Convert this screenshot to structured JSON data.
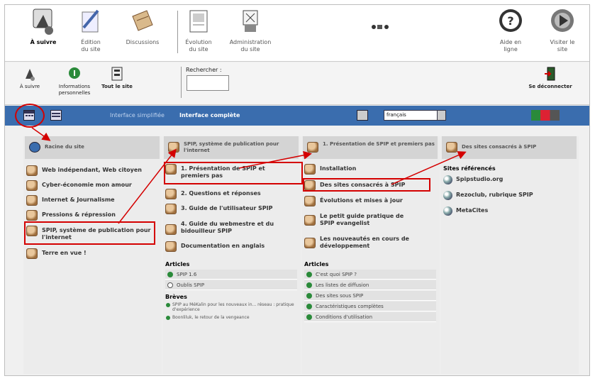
{
  "toolbar": {
    "items": [
      {
        "label": "À suivre",
        "icon": "follow-icon"
      },
      {
        "label": "Édition\ndu site",
        "icon": "edit-icon"
      },
      {
        "label": "Discussions",
        "icon": "discussions-icon"
      },
      {
        "label": "Évolution\ndu site",
        "icon": "evolution-icon"
      },
      {
        "label": "Administration\ndu site",
        "icon": "admin-icon"
      },
      {
        "label": "Aide en\nligne",
        "icon": "help-icon"
      },
      {
        "label": "Visiter le\nsite",
        "icon": "visit-icon"
      }
    ]
  },
  "second": {
    "follow": "À suivre",
    "personal": "Informations\npersonnelles",
    "all_site": "Tout le site",
    "search_label": "Rechercher :",
    "logout": "Se déconnecter"
  },
  "bluebar": {
    "simplified": "Interface simplifiée",
    "complete": "Interface complète",
    "language": "français"
  },
  "col1": {
    "head": "Racine du site",
    "items": [
      "Web indépendant, Web citoyen",
      "Cyber-économie mon amour",
      "Internet & Journalisme",
      "Pressions & répression",
      "SPIP, système de publication pour l'internet",
      "Terre en vue !"
    ]
  },
  "col2": {
    "head": "SPIP, système de publication pour l'internet",
    "items": [
      "1. Présentation de SPIP et premiers pas",
      "2. Questions et réponses",
      "3. Guide de l'utilisateur SPIP",
      "4. Guide du webmestre et du bidouilleur SPIP",
      "Documentation en anglais"
    ],
    "articles_title": "Articles",
    "articles": [
      "SPIP 1.6",
      "Oublis SPIP"
    ],
    "breves_title": "Brèves",
    "breves": [
      "SPIP au MéKalin pour les nouveaux in... réseau : pratique d'expérience",
      "Boonliluk, le retour de la vengeance"
    ]
  },
  "col3": {
    "head": "1. Présentation de SPIP et premiers pas",
    "items": [
      "Installation",
      "Des sites consacrés à SPIP",
      "Évolutions et mises à jour",
      "Le petit guide pratique de SPIP evangelist",
      "Les nouveautés en cours de développement"
    ],
    "articles_title": "Articles",
    "articles": [
      "C'est quoi SPIP ?",
      "Les listes de diffusion",
      "Des sites sous SPIP",
      "Caractéristiques complètes",
      "Conditions d'utilisation"
    ]
  },
  "col4": {
    "head": "Des sites consacrés à SPIP",
    "sites_title": "Sites référencés",
    "sites": [
      "Spipstudio.org",
      "Rezoclub, rubrique SPIP",
      "MetaCites"
    ]
  },
  "colors": {
    "blue_bar": "#3a6dae",
    "highlight": "#d40000",
    "active_dot": "#2a8a3a"
  }
}
